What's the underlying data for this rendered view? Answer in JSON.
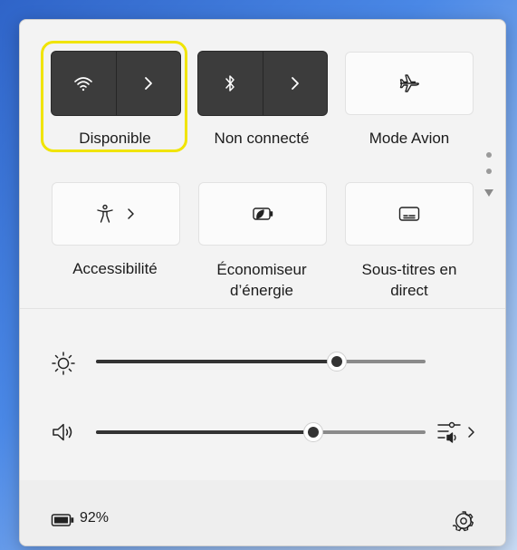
{
  "quick_settings": {
    "wifi": {
      "label": "Disponible",
      "icon": "wifi-icon"
    },
    "bluetooth": {
      "label": "Non connecté",
      "icon": "bluetooth-icon"
    },
    "airplane": {
      "label": "Mode Avion",
      "icon": "airplane-icon"
    },
    "accessibility": {
      "label": "Accessibilité",
      "icon": "accessibility-icon"
    },
    "energy_saver": {
      "label_line1": "Économiseur",
      "label_line2": "d’énergie",
      "icon": "energy-saver-icon"
    },
    "live_captions": {
      "label_line1": "Sous-titres en",
      "label_line2": "direct",
      "icon": "captions-icon"
    }
  },
  "sliders": {
    "brightness": {
      "icon": "brightness-icon",
      "value_percent": 73
    },
    "volume": {
      "icon": "speaker-icon",
      "value_percent": 66
    }
  },
  "footer": {
    "battery_percent": "92%",
    "battery_icon": "battery-icon",
    "settings_icon": "gear-icon"
  },
  "colors": {
    "highlight": "#f0e400",
    "tile_active": "#3c3c3c",
    "panel_bg": "#f3f3f3"
  }
}
